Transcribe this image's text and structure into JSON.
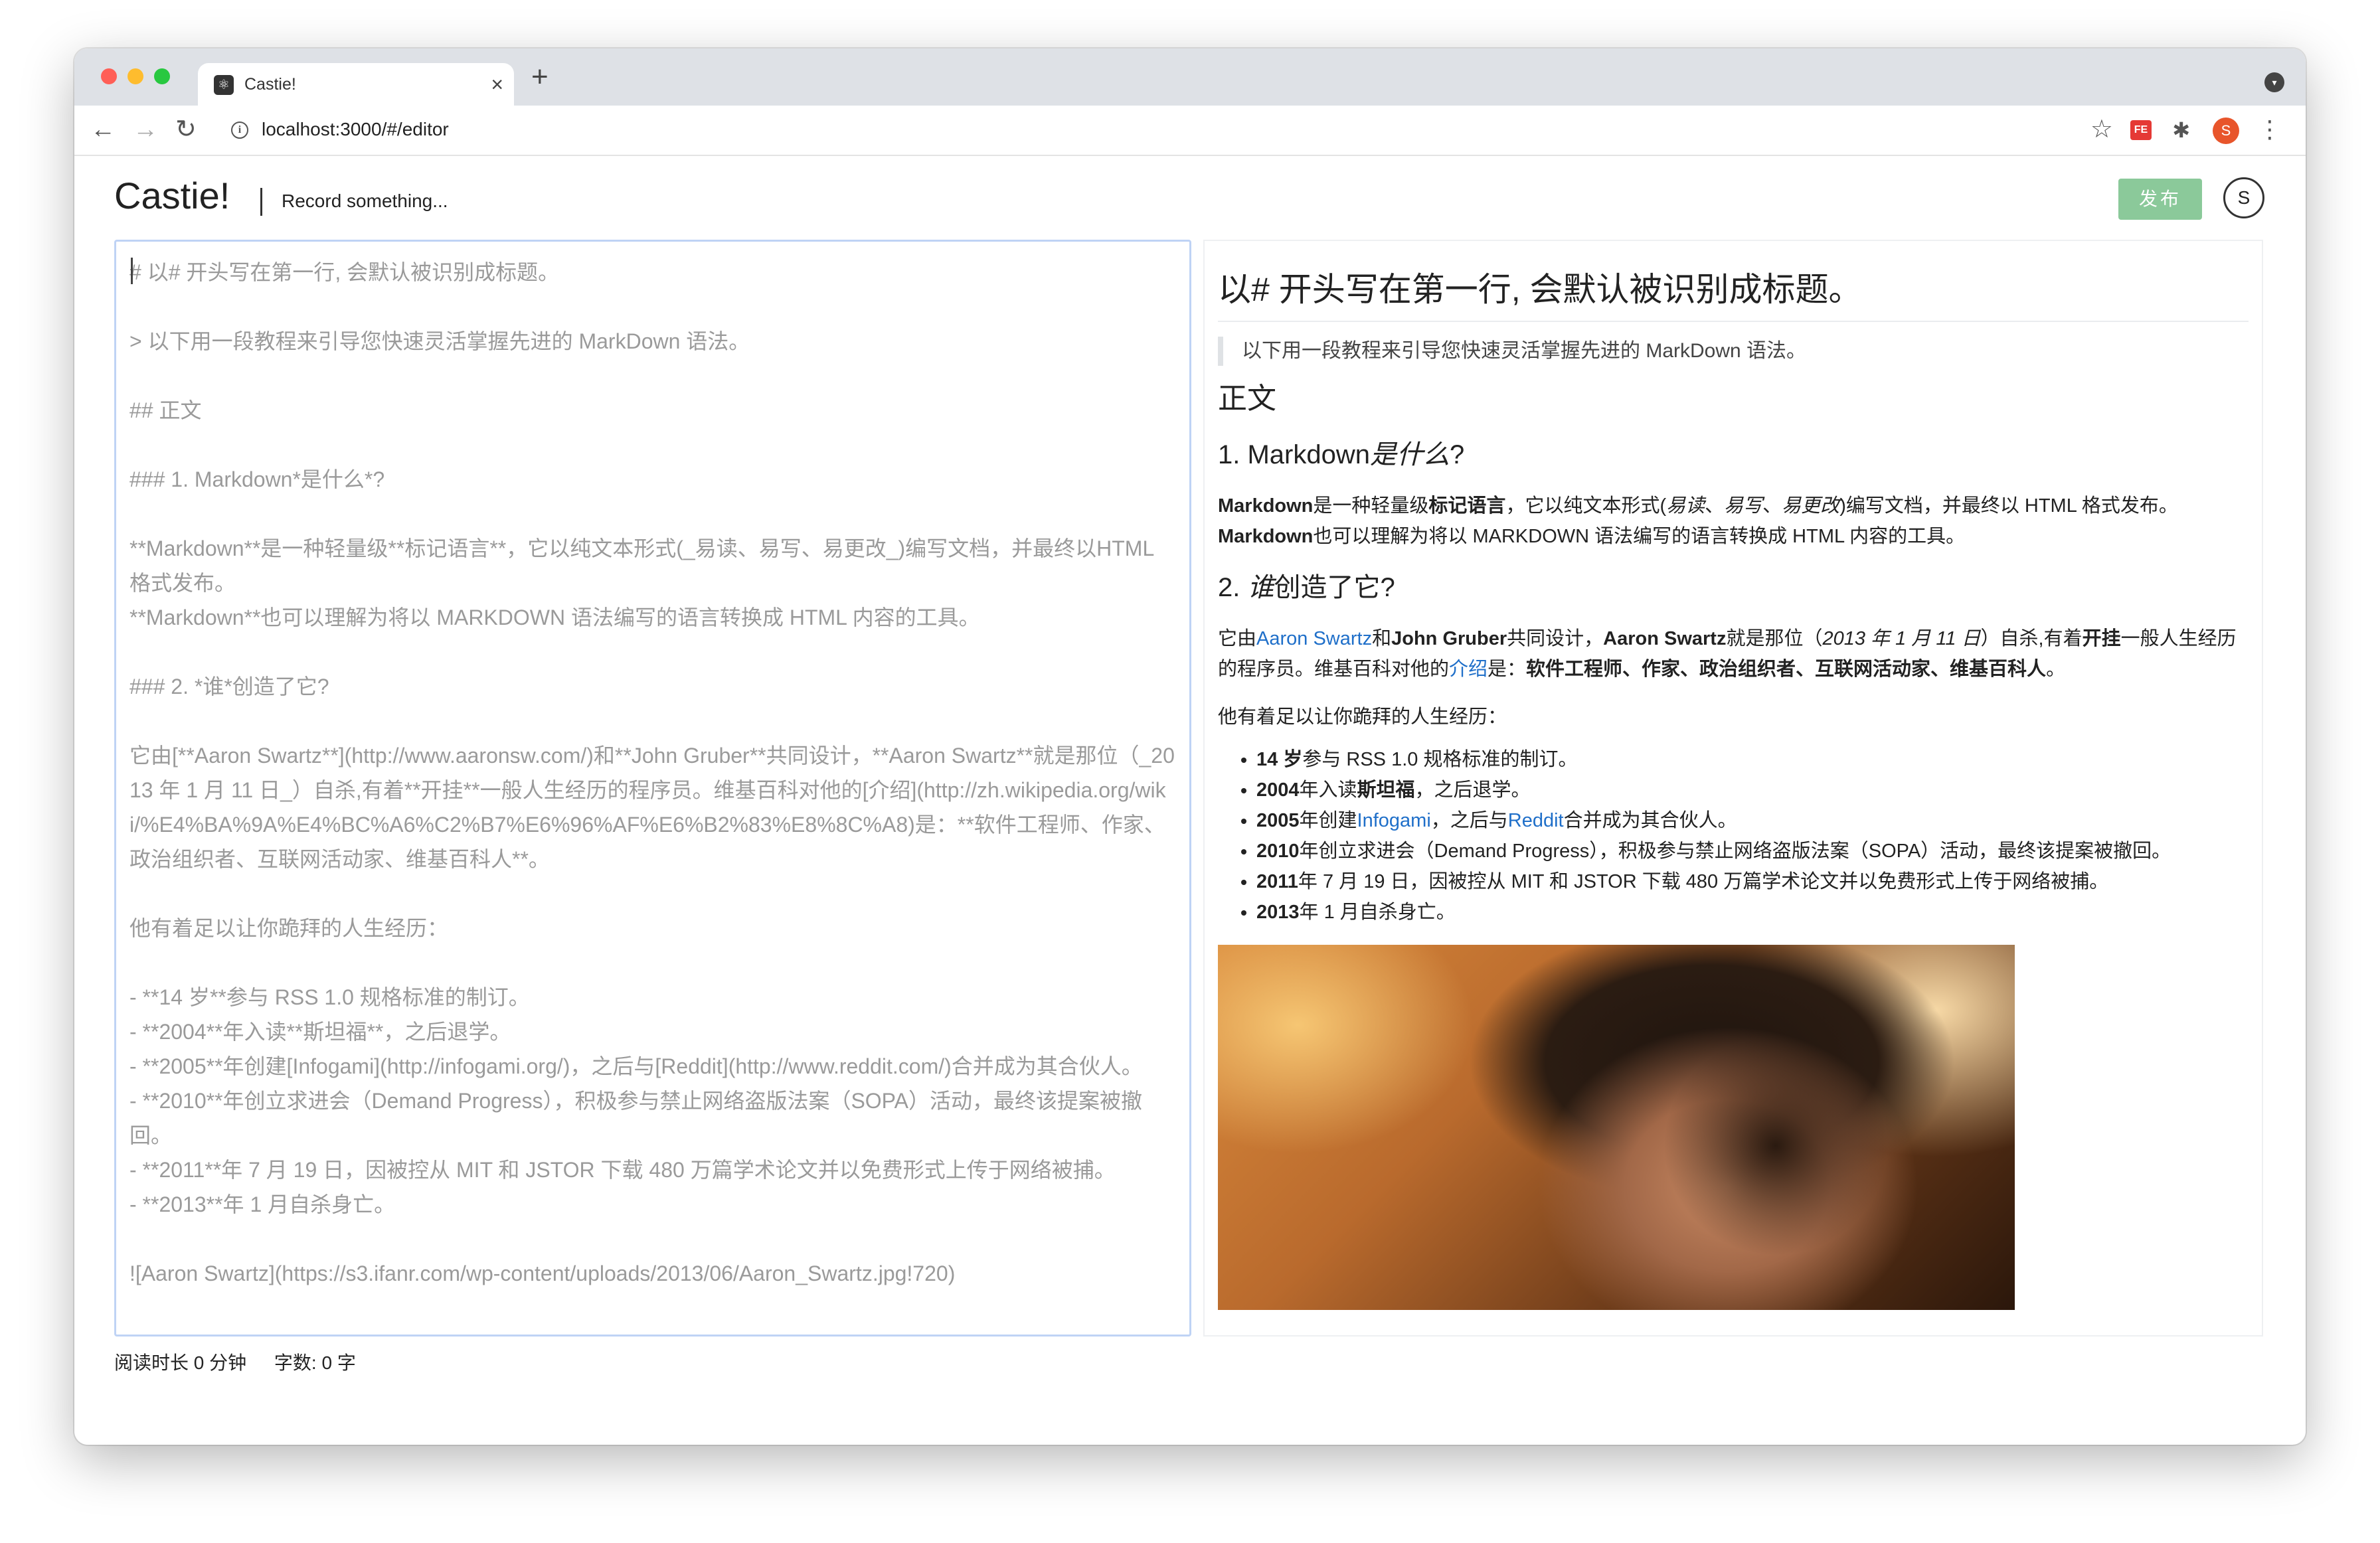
{
  "browser": {
    "tab_title": "Castie!",
    "tab_favicon_icon": "react-logo-icon",
    "close_glyph": "×",
    "new_tab_glyph": "+",
    "url": "localhost:3000/#/editor",
    "extension_fe_label": "FE",
    "profile_initial": "S"
  },
  "app": {
    "title": "Castie!",
    "record_status": "Record something...",
    "publish_label": "发布",
    "user_initial": "S"
  },
  "editor": {
    "lines": [
      "# 以# 开头写在第一行, 会默认被识别成标题。",
      "",
      "> 以下用一段教程来引导您快速灵活掌握先进的 MarkDown 语法。",
      "",
      "## 正文",
      "",
      "### 1. Markdown*是什么*?",
      "",
      "**Markdown**是一种轻量级**标记语言**，它以纯文本形式(_易读、易写、易更改_)编写文档，并最终以HTML 格式发布。",
      "**Markdown**也可以理解为将以 MARKDOWN 语法编写的语言转换成 HTML 内容的工具。",
      "",
      "### 2. *谁*创造了它?",
      "",
      "它由[**Aaron Swartz**](http://www.aaronsw.com/)和**John Gruber**共同设计，**Aaron Swartz**就是那位（_2013 年 1 月 11 日_）自杀,有着**开挂**一般人生经历的程序员。维基百科对他的[介绍](http://zh.wikipedia.org/wiki/%E4%BA%9A%E4%BC%A6%C2%B7%E6%96%AF%E6%B2%83%E8%8C%A8)是：**软件工程师、作家、政治组织者、互联网活动家、维基百科人**。",
      "",
      "他有着足以让你跪拜的人生经历：",
      "",
      "- **14 岁**参与 RSS 1.0 规格标准的制订。",
      "- **2004**年入读**斯坦福**，之后退学。",
      "- **2005**年创建[Infogami](http://infogami.org/)，之后与[Reddit](http://www.reddit.com/)合并成为其合伙人。",
      "- **2010**年创立求进会（Demand Progress），积极参与禁止网络盗版法案（SOPA）活动，最终该提案被撤回。",
      "- **2011**年 7 月 19 日，因被控从 MIT 和 JSTOR 下载 480 万篇学术论文并以免费形式上传于网络被捕。",
      "- **2013**年 1 月自杀身亡。",
      "",
      "![Aaron Swartz](https://s3.ifanr.com/wp-content/uploads/2013/06/Aaron_Swartz.jpg!720)"
    ]
  },
  "status": {
    "reading_time": "阅读时长 0 分钟",
    "word_count": "字数: 0 字"
  },
  "preview": {
    "h1": "以# 开头写在第一行, 会默认被识别成标题。",
    "quote": "以下用一段教程来引导您快速灵活掌握先进的 MarkDown 语法。",
    "h2": "正文",
    "sec1": {
      "num": "1. Markdown",
      "em": "是什么",
      "tail": "?"
    },
    "p1": {
      "b1": "Markdown",
      "t1": "是一种轻量级",
      "b2": "标记语言",
      "t2": "，它以纯文本形式(",
      "e1": "易读",
      "t3": "、",
      "e2": "易写",
      "t4": "、",
      "e3": "易更改",
      "t5": ")编写文档，并最终以 HTML 格式发布。"
    },
    "p1b": {
      "b1": "Markdown",
      "t1": "也可以理解为将以 MARKDOWN 语法编写的语言转换成 HTML 内容的工具。"
    },
    "sec2": {
      "num": "2. ",
      "em": "谁",
      "tail": "创造了它?"
    },
    "p2": {
      "t0": "它由",
      "link1": "Aaron Swartz",
      "t1": "和",
      "b1": "John Gruber",
      "t2": "共同设计，",
      "b2": "Aaron Swartz",
      "t3": "就是那位（",
      "e1": "2013 年 1 月 11 日",
      "t4": "）自杀,有着",
      "b3": "开挂",
      "t5": "一般人生经历的程序员。维基百科对他的",
      "link2": "介绍",
      "t6": "是：",
      "b4": "软件工程师、作家、政治组织者、互联网活动家、维基百科人",
      "t7": "。"
    },
    "p3": "他有着足以让你跪拜的人生经历：",
    "list": {
      "i1": {
        "b": "14 岁",
        "t": "参与 RSS 1.0 规格标准的制订。"
      },
      "i2": {
        "b": "2004",
        "t1": "年入读",
        "b2": "斯坦福",
        "t2": "，之后退学。"
      },
      "i3": {
        "b": "2005",
        "t1": "年创建",
        "link1": "Infogami",
        "t2": "，之后与",
        "link2": "Reddit",
        "t3": "合并成为其合伙人。"
      },
      "i4": {
        "b": "2010",
        "t": "年创立求进会（Demand Progress），积极参与禁止网络盗版法案（SOPA）活动，最终该提案被撤回。"
      },
      "i5": {
        "b": "2011",
        "t": "年 7 月 19 日，因被控从 MIT 和 JSTOR 下载 480 万篇学术论文并以免费形式上传于网络被捕。"
      },
      "i6": {
        "b": "2013",
        "t": "年 1 月自杀身亡。"
      }
    }
  }
}
